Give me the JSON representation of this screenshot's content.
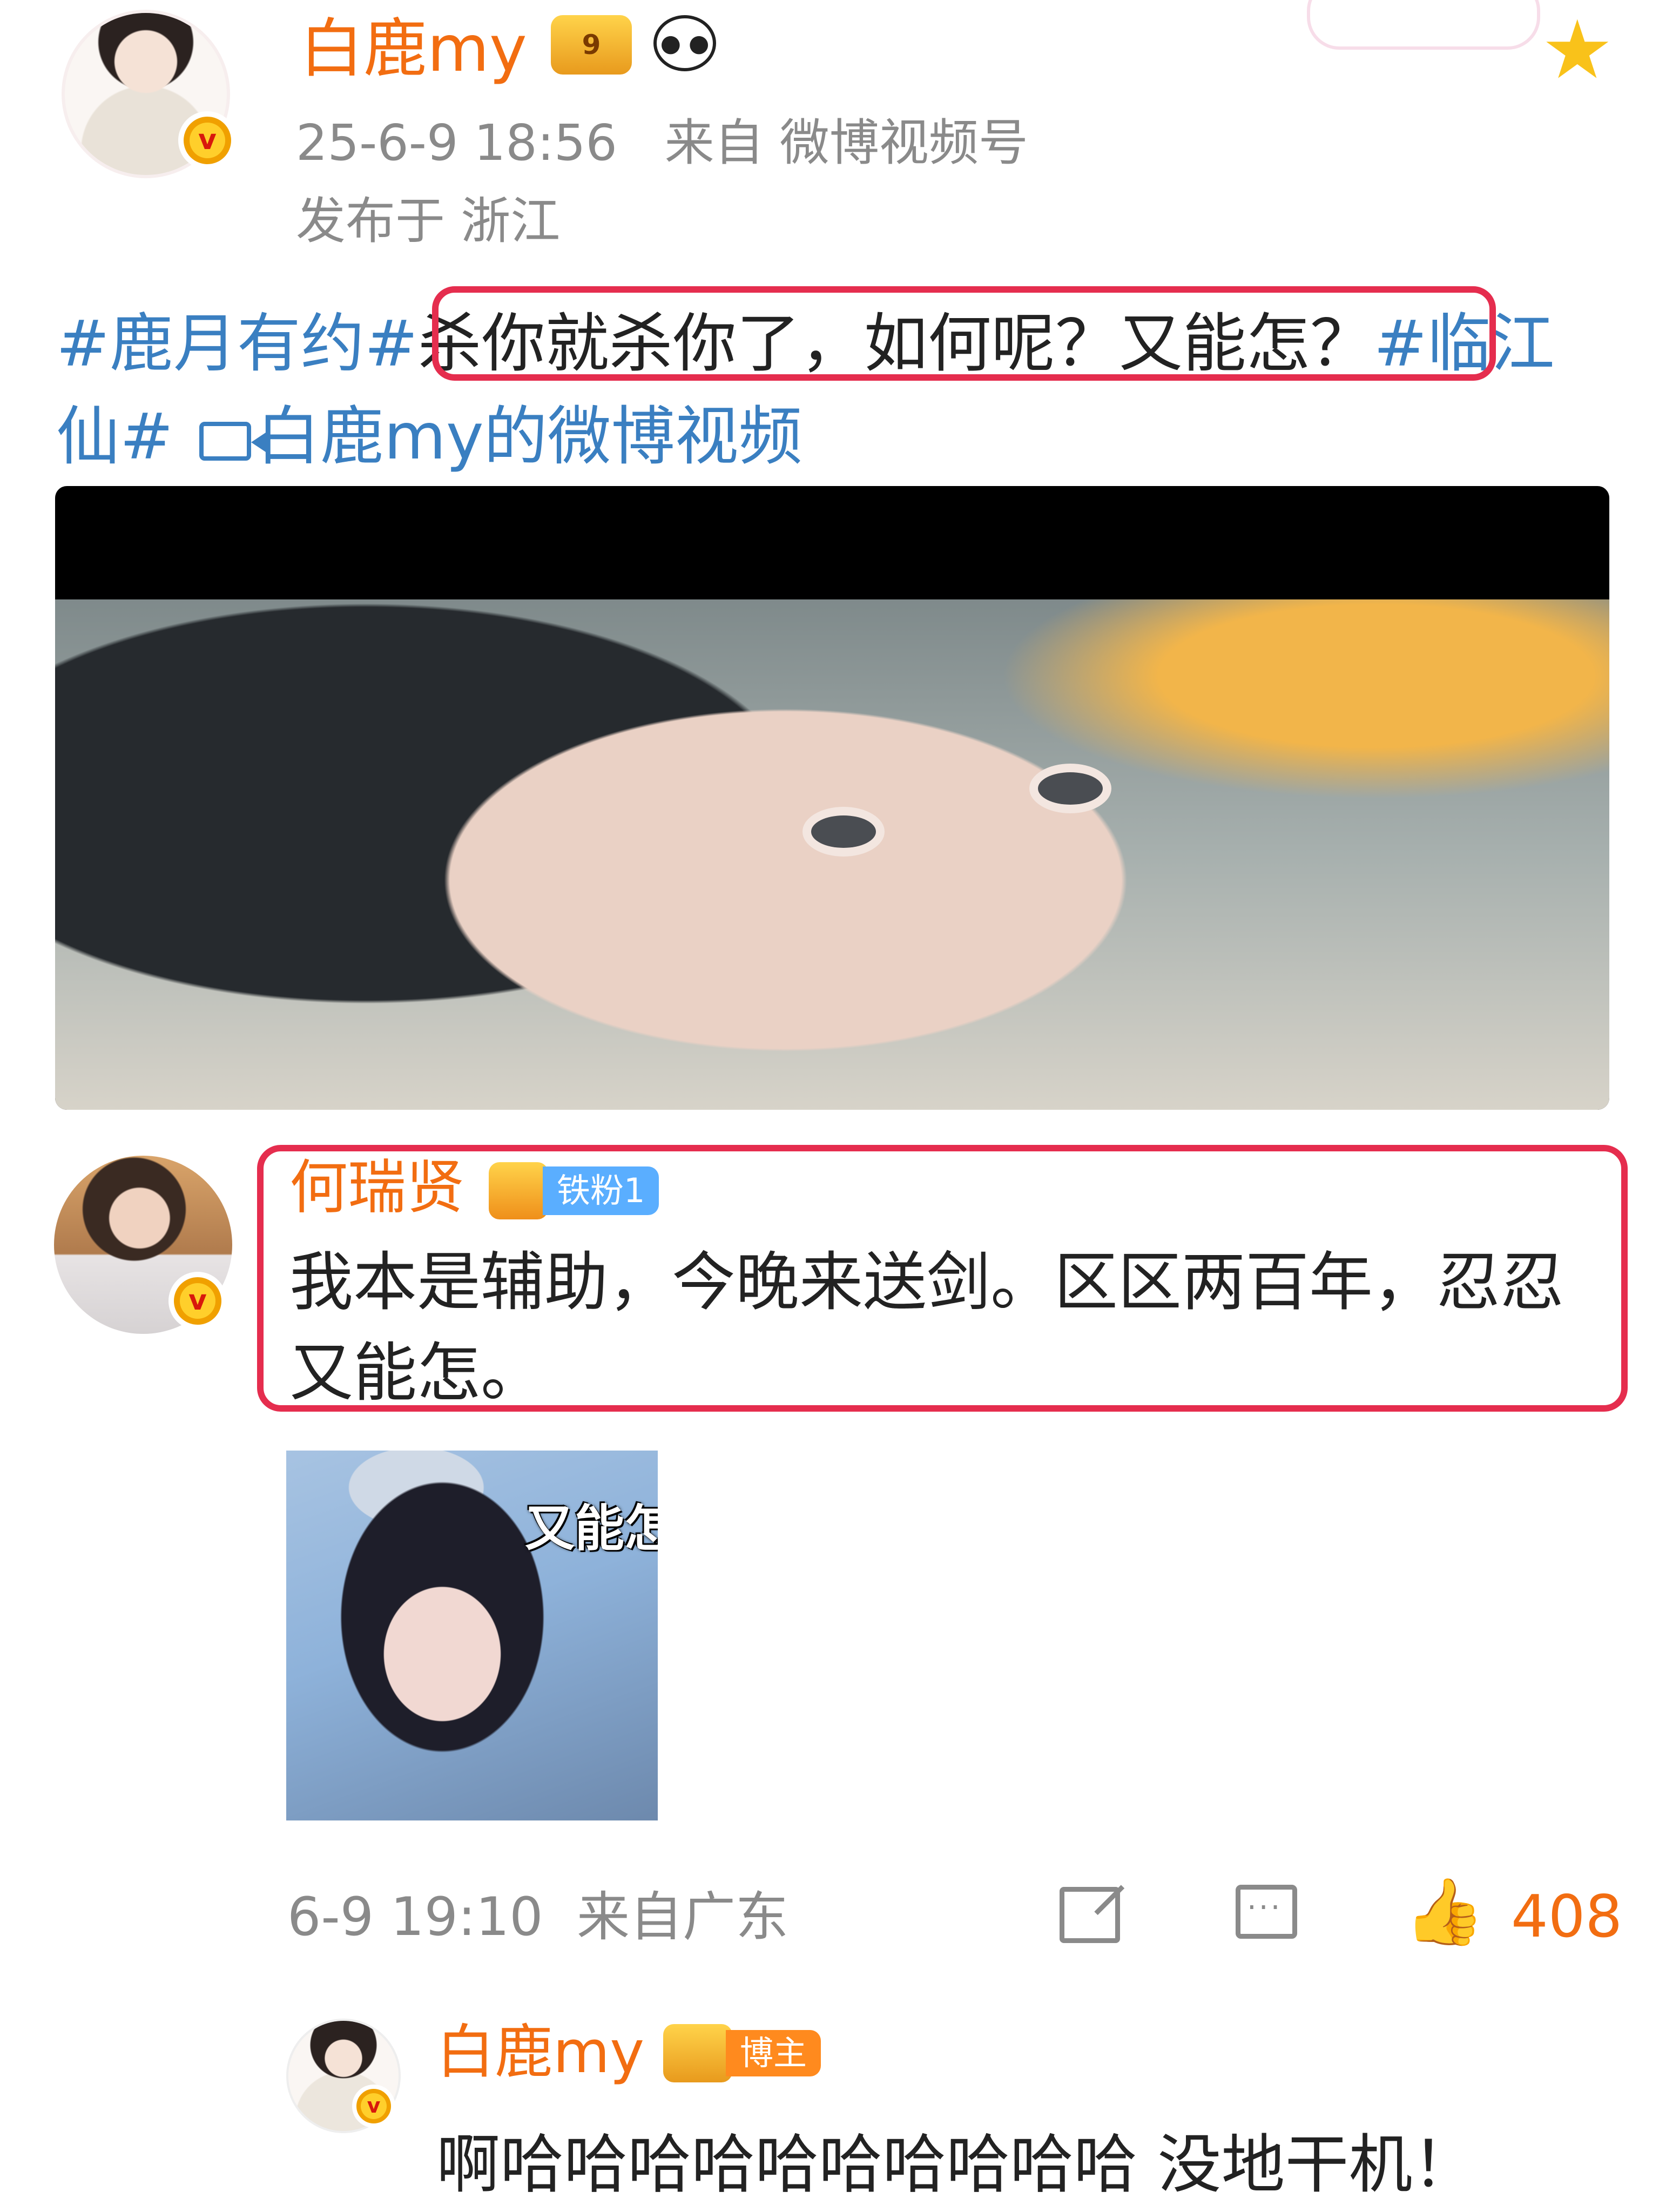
{
  "post": {
    "author": "白鹿my",
    "author_level": "9",
    "time_source": "25-6-9 18:56   来自 微博视频号",
    "location": "发布于 浙江",
    "text": {
      "tag1": "#鹿月有约#",
      "body": "杀你就杀你了，如何呢？又能怎？",
      "tag2": "#临江仙#",
      "video_link": "白鹿my的微博视频"
    }
  },
  "comment": {
    "author": "何瑞贤",
    "fan_badge": "铁粉1",
    "text": "我本是辅助，今晚来送剑。区区两百年，忍忍又能怎。",
    "sticker_caption": "又能怎",
    "meta": "6-9 19:10  来自广东",
    "likes": "408"
  },
  "reply": {
    "author": "白鹿my",
    "badge": "博主",
    "text": "啊哈哈哈哈哈哈哈哈哈哈 没地干机！"
  },
  "colors": {
    "name_orange": "#f26d11",
    "link_blue": "#3a7fc1",
    "highlight_red": "#e52d4e",
    "meta_gray": "#8a8a8a"
  }
}
